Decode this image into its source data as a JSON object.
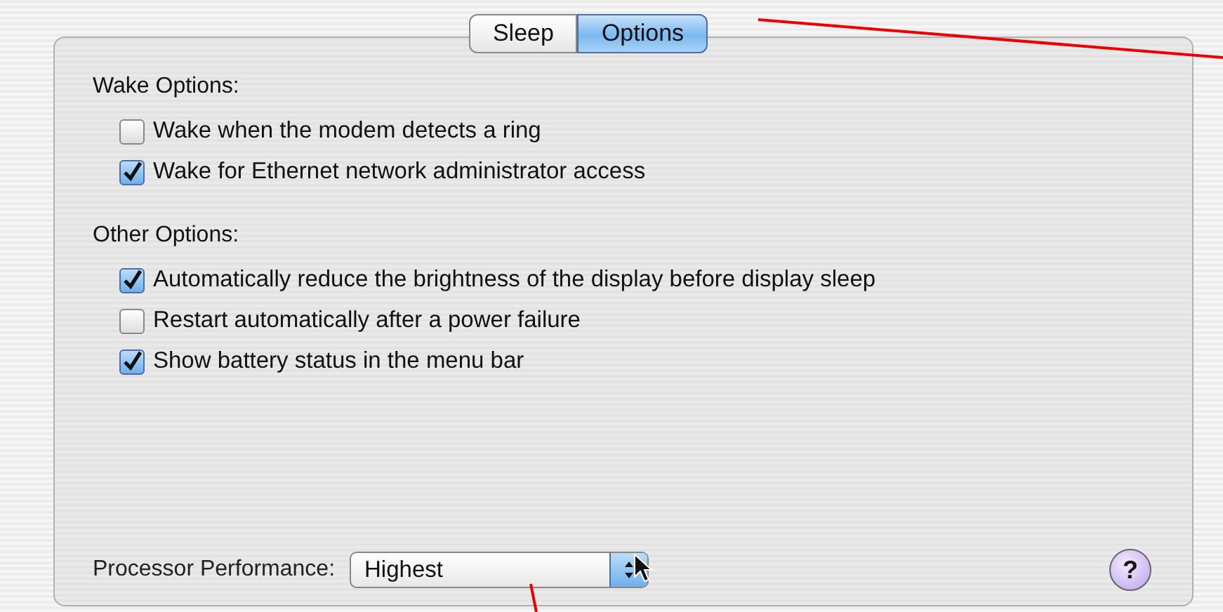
{
  "tabs": [
    {
      "label": "Sleep",
      "selected": false
    },
    {
      "label": "Options",
      "selected": true
    }
  ],
  "sections": [
    {
      "title": "Wake Options:",
      "options": [
        {
          "label": "Wake when the modem detects a ring",
          "checked": false
        },
        {
          "label": "Wake for Ethernet network administrator access",
          "checked": true
        }
      ]
    },
    {
      "title": "Other Options:",
      "options": [
        {
          "label": "Automatically reduce the brightness of the display before display sleep",
          "checked": true
        },
        {
          "label": "Restart automatically after a power failure",
          "checked": false
        },
        {
          "label": "Show battery status in the menu bar",
          "checked": true
        }
      ]
    }
  ],
  "processor_performance": {
    "label": "Processor Performance:",
    "value": "Highest"
  },
  "help_button": {
    "label": "?"
  }
}
